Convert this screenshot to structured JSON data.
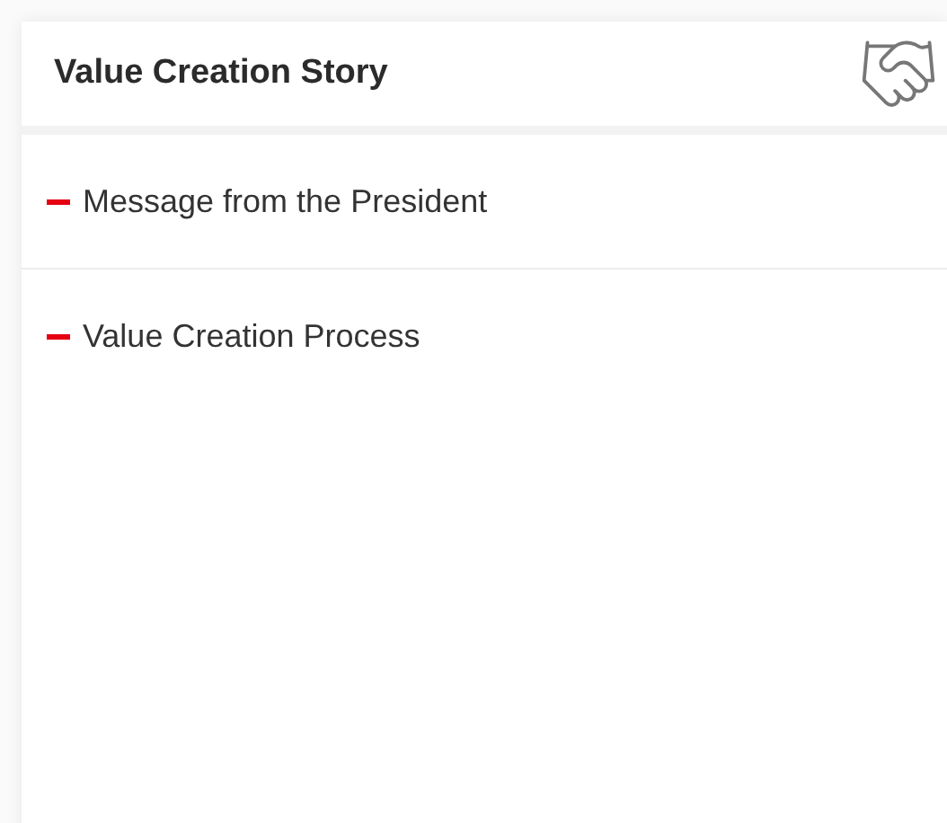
{
  "panel": {
    "title": "Value Creation Story"
  },
  "links": [
    {
      "label": "Message from the President"
    },
    {
      "label": "Value Creation Process"
    }
  ]
}
